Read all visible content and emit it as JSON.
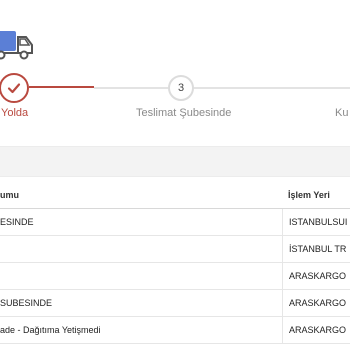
{
  "icons": {
    "truck": "truck-icon",
    "check": "check-icon"
  },
  "colors": {
    "accent": "#b9493f",
    "truck": "#5b7fd6",
    "muted": "#8a8a8a"
  },
  "tracker": {
    "steps": [
      {
        "label": "Yolda",
        "state": "active"
      },
      {
        "number": "3",
        "label": "Teslimat Şubesinde",
        "state": "pending"
      },
      {
        "label": "Ku",
        "state": "pending"
      }
    ]
  },
  "table": {
    "headers": {
      "status": "umu",
      "place": "İşlem Yeri"
    },
    "rows": [
      {
        "status": "ESINDE",
        "place": "ISTANBULSUI"
      },
      {
        "status": "",
        "place": "İSTANBUL TR"
      },
      {
        "status": "",
        "place": "ARASKARGO"
      },
      {
        "status": " SUBESINDE",
        "place": "ARASKARGO"
      },
      {
        "status": "ade - Dağıtıma Yetişmedi",
        "place": "ARASKARGO"
      }
    ]
  }
}
